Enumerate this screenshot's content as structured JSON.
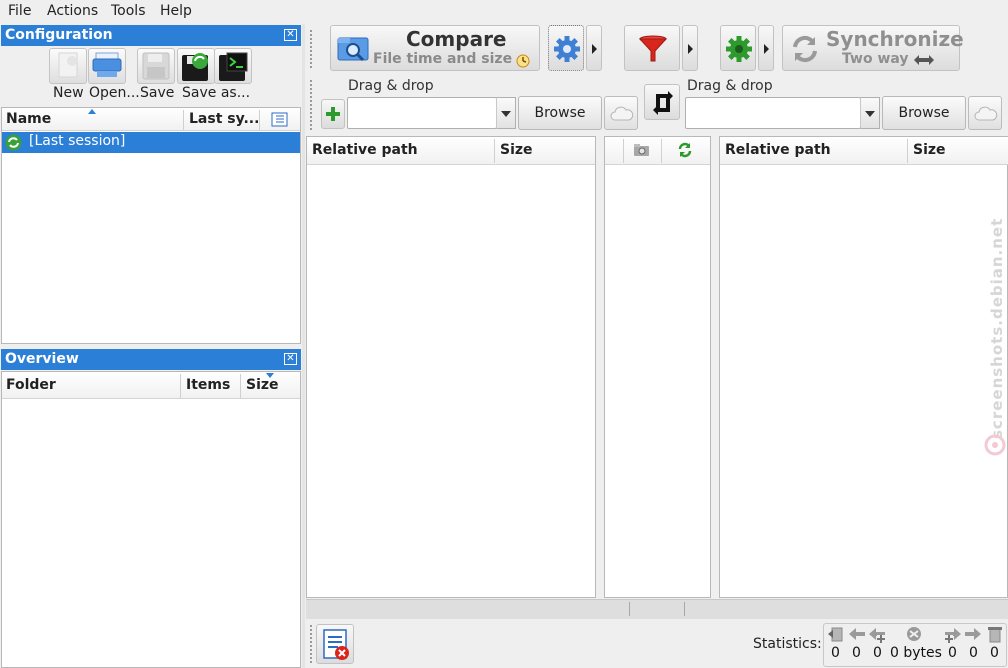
{
  "menu": [
    "File",
    "Actions",
    "Tools",
    "Help"
  ],
  "config_panel": {
    "title": "Configuration",
    "buttons": [
      "New",
      "Open...",
      "Save",
      "Save as..."
    ],
    "columns": [
      "Name",
      "Last sy..."
    ],
    "sessions": [
      "[Last session]"
    ]
  },
  "overview_panel": {
    "title": "Overview",
    "columns": [
      "Folder",
      "Items",
      "Size"
    ]
  },
  "toolbar": {
    "compare_label": "Compare",
    "compare_sub": "File time and size",
    "sync_label": "Synchronize",
    "sync_sub": "Two way"
  },
  "left_folder": {
    "drag_label": "Drag & drop",
    "browse_label": "Browse",
    "value": ""
  },
  "right_folder": {
    "drag_label": "Drag & drop",
    "browse_label": "Browse",
    "value": ""
  },
  "grid": {
    "left_columns": [
      "Relative path",
      "Size"
    ],
    "right_columns": [
      "Relative path",
      "Size"
    ]
  },
  "statistics": {
    "label": "Statistics:",
    "values": [
      "0",
      "0",
      "0",
      "0 bytes",
      "0",
      "0",
      "0"
    ]
  },
  "watermark": "screenshots.debian.net",
  "colors": {
    "accent": "#2c7fd6",
    "selection": "#2c7fd6",
    "filter_red": "#d9261c",
    "gear_blue": "#3f7fd4",
    "gear_green": "#2e9a2e"
  }
}
